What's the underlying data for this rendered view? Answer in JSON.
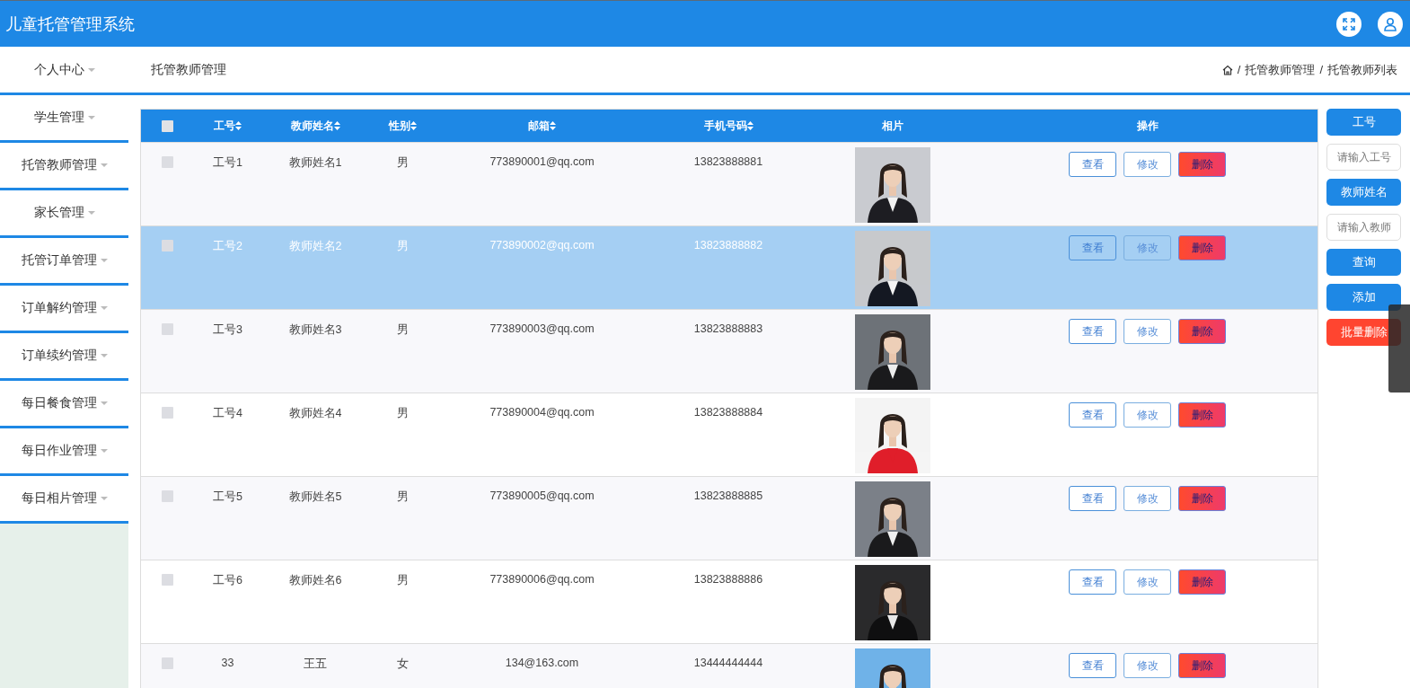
{
  "header": {
    "title": "儿童托管管理系统"
  },
  "sidebar": {
    "items": [
      {
        "label": "个人中心",
        "expanded": false
      },
      {
        "label": "学生管理",
        "expanded": false
      },
      {
        "label": "托管教师管理",
        "expanded": false
      },
      {
        "label": "家长管理",
        "expanded": false
      },
      {
        "label": "托管订单管理",
        "expanded": false
      },
      {
        "label": "订单解约管理",
        "expanded": false
      },
      {
        "label": "订单续约管理",
        "expanded": false
      },
      {
        "label": "每日餐食管理",
        "expanded": false
      },
      {
        "label": "每日作业管理",
        "expanded": false
      },
      {
        "label": "每日相片管理",
        "expanded": false
      }
    ]
  },
  "page_title": "托管教师管理",
  "breadcrumb": [
    {
      "separator": "/",
      "label": "托管教师管理"
    },
    {
      "separator": "/",
      "label": "托管教师列表"
    }
  ],
  "table": {
    "header_checkbox": {
      "checked": false
    },
    "columns": [
      {
        "label": "工号",
        "sortable": true
      },
      {
        "label": "教师姓名",
        "sortable": true
      },
      {
        "label": "性别",
        "sortable": true
      },
      {
        "label": "邮箱",
        "sortable": true
      },
      {
        "label": "手机号码",
        "sortable": true
      },
      {
        "label": "相片",
        "sortable": false
      },
      {
        "label": "操作",
        "sortable": false
      }
    ],
    "rows": [
      {
        "checked": false,
        "selected": false,
        "cells": [
          "工号1",
          "教师姓名1",
          "男",
          "773890001@qq.com",
          "13823888881"
        ],
        "actions": [
          {
            "label": "查看",
            "kind": "view"
          },
          {
            "label": "修改",
            "kind": "edit"
          },
          {
            "label": "删除",
            "kind": "delete"
          }
        ]
      },
      {
        "checked": false,
        "selected": true,
        "cells": [
          "工号2",
          "教师姓名2",
          "男",
          "773890002@qq.com",
          "13823888882"
        ],
        "actions": [
          {
            "label": "查看",
            "kind": "view"
          },
          {
            "label": "修改",
            "kind": "edit"
          },
          {
            "label": "删除",
            "kind": "delete"
          }
        ]
      },
      {
        "checked": false,
        "selected": false,
        "cells": [
          "工号3",
          "教师姓名3",
          "男",
          "773890003@qq.com",
          "13823888883"
        ],
        "actions": [
          {
            "label": "查看",
            "kind": "view"
          },
          {
            "label": "修改",
            "kind": "edit"
          },
          {
            "label": "删除",
            "kind": "delete"
          }
        ]
      },
      {
        "checked": false,
        "selected": false,
        "cells": [
          "工号4",
          "教师姓名4",
          "男",
          "773890004@qq.com",
          "13823888884"
        ],
        "actions": [
          {
            "label": "查看",
            "kind": "view"
          },
          {
            "label": "修改",
            "kind": "edit"
          },
          {
            "label": "删除",
            "kind": "delete"
          }
        ]
      },
      {
        "checked": false,
        "selected": false,
        "cells": [
          "工号5",
          "教师姓名5",
          "男",
          "773890005@qq.com",
          "13823888885"
        ],
        "actions": [
          {
            "label": "查看",
            "kind": "view"
          },
          {
            "label": "修改",
            "kind": "edit"
          },
          {
            "label": "删除",
            "kind": "delete"
          }
        ]
      },
      {
        "checked": false,
        "selected": false,
        "cells": [
          "工号6",
          "教师姓名6",
          "男",
          "773890006@qq.com",
          "13823888886"
        ],
        "actions": [
          {
            "label": "查看",
            "kind": "view"
          },
          {
            "label": "修改",
            "kind": "edit"
          },
          {
            "label": "删除",
            "kind": "delete"
          }
        ]
      },
      {
        "checked": false,
        "selected": false,
        "cells": [
          "33",
          "王五",
          "女",
          "134@163.com",
          "13444444444"
        ],
        "actions": [
          {
            "label": "查看",
            "kind": "view"
          },
          {
            "label": "修改",
            "kind": "edit"
          },
          {
            "label": "删除",
            "kind": "delete"
          }
        ]
      }
    ]
  },
  "search_panel": {
    "items": [
      {
        "kind": "label",
        "text": "工号"
      },
      {
        "kind": "field",
        "placeholder": "请输入工号"
      },
      {
        "kind": "label",
        "text": "教师姓名"
      },
      {
        "kind": "field",
        "placeholder": "请输入教师"
      },
      {
        "kind": "button",
        "text": "查询"
      },
      {
        "kind": "button",
        "text": "添加"
      },
      {
        "kind": "danger",
        "text": "批量删除"
      }
    ]
  }
}
